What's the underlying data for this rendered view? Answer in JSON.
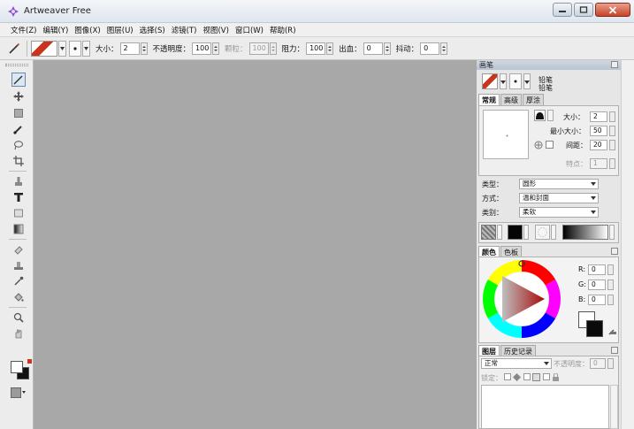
{
  "window": {
    "title": "Artweaver Free"
  },
  "menu": [
    "文件(Z)",
    "编辑(Y)",
    "图像(X)",
    "图层(U)",
    "选择(S)",
    "滤镜(T)",
    "视图(V)",
    "窗口(W)",
    "帮助(R)"
  ],
  "options": {
    "size_label": "大小：",
    "size_value": "2",
    "opacity_label": "不透明度：",
    "opacity_value": "100",
    "grain_label": "颗粒：",
    "grain_value": "100",
    "resist_label": "阻力：",
    "resist_value": "100",
    "bleed_label": "出血：",
    "bleed_value": "0",
    "jitter_label": "抖动：",
    "jitter_value": "0"
  },
  "brush_panel": {
    "title": "画笔",
    "category": "铅笔",
    "variant": "铅笔",
    "tabs": [
      "常规",
      "高级",
      "厚涂"
    ],
    "size_label": "大小：",
    "size_value": "2",
    "min_size_label": "最小大小：",
    "min_size_value": "50",
    "spacing_label": "间距：",
    "spacing_value": "20",
    "feature_label": "特点：",
    "feature_value": "1",
    "type_label": "类型：",
    "type_value": "圆形",
    "method_label": "方式：",
    "method_value": "温和封面",
    "source_label": "类别：",
    "source_value": "柔软"
  },
  "color_panel": {
    "tabs": [
      "颜色",
      "色板"
    ],
    "r_label": "R:",
    "r_value": "0",
    "g_label": "G:",
    "g_value": "0",
    "b_label": "B:",
    "b_value": "0"
  },
  "layers_panel": {
    "tabs": [
      "图层",
      "历史记录"
    ],
    "blend_value": "正常",
    "opacity_label": "不透明度：",
    "opacity_value": "0",
    "lock_label": "锁定："
  },
  "colors": {
    "canvas": "#a8a8a8",
    "accent_red": "#c9341c",
    "close_button": "#c84128"
  }
}
